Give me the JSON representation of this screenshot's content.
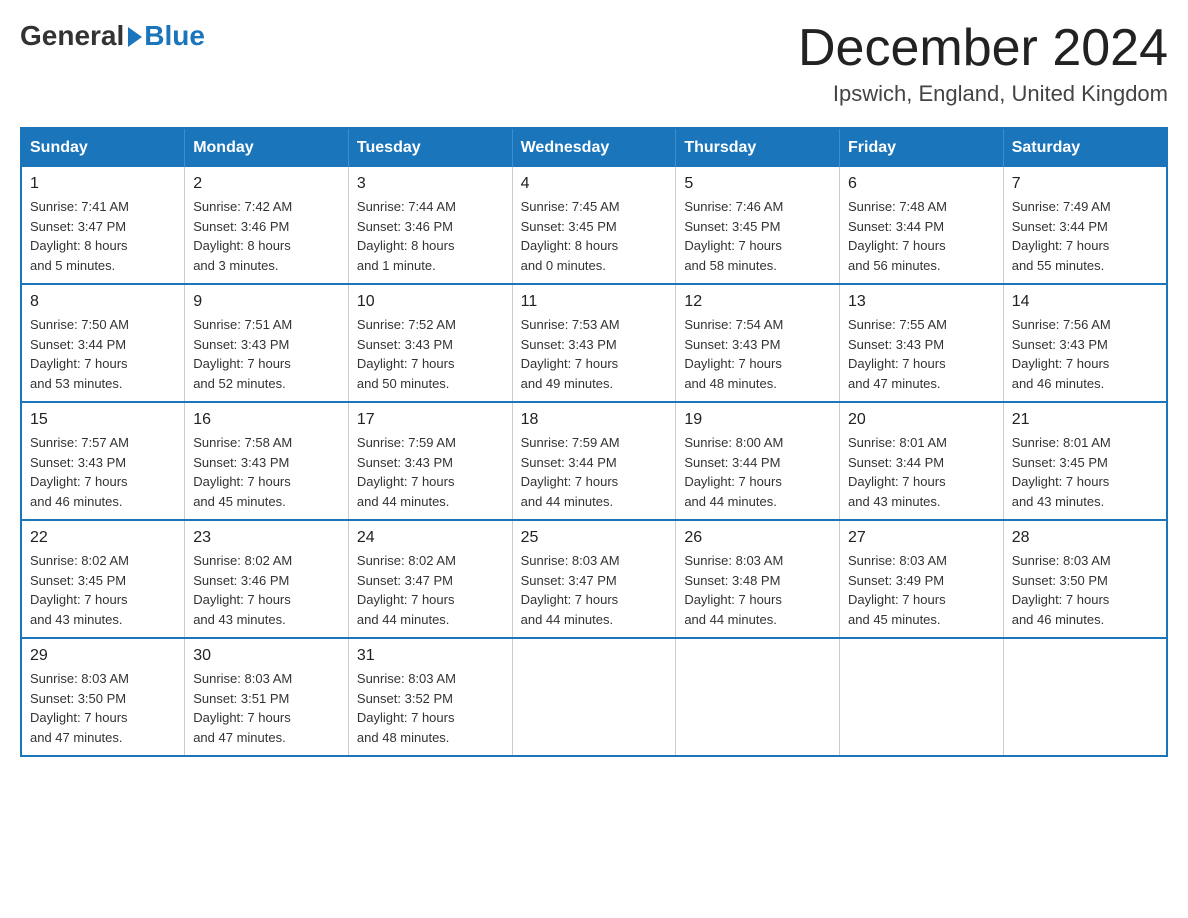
{
  "logo": {
    "general": "General",
    "blue": "Blue"
  },
  "title": "December 2024",
  "location": "Ipswich, England, United Kingdom",
  "days_of_week": [
    "Sunday",
    "Monday",
    "Tuesday",
    "Wednesday",
    "Thursday",
    "Friday",
    "Saturday"
  ],
  "weeks": [
    [
      {
        "day": "1",
        "sunrise": "7:41 AM",
        "sunset": "3:47 PM",
        "daylight": "8 hours and 5 minutes."
      },
      {
        "day": "2",
        "sunrise": "7:42 AM",
        "sunset": "3:46 PM",
        "daylight": "8 hours and 3 minutes."
      },
      {
        "day": "3",
        "sunrise": "7:44 AM",
        "sunset": "3:46 PM",
        "daylight": "8 hours and 1 minute."
      },
      {
        "day": "4",
        "sunrise": "7:45 AM",
        "sunset": "3:45 PM",
        "daylight": "8 hours and 0 minutes."
      },
      {
        "day": "5",
        "sunrise": "7:46 AM",
        "sunset": "3:45 PM",
        "daylight": "7 hours and 58 minutes."
      },
      {
        "day": "6",
        "sunrise": "7:48 AM",
        "sunset": "3:44 PM",
        "daylight": "7 hours and 56 minutes."
      },
      {
        "day": "7",
        "sunrise": "7:49 AM",
        "sunset": "3:44 PM",
        "daylight": "7 hours and 55 minutes."
      }
    ],
    [
      {
        "day": "8",
        "sunrise": "7:50 AM",
        "sunset": "3:44 PM",
        "daylight": "7 hours and 53 minutes."
      },
      {
        "day": "9",
        "sunrise": "7:51 AM",
        "sunset": "3:43 PM",
        "daylight": "7 hours and 52 minutes."
      },
      {
        "day": "10",
        "sunrise": "7:52 AM",
        "sunset": "3:43 PM",
        "daylight": "7 hours and 50 minutes."
      },
      {
        "day": "11",
        "sunrise": "7:53 AM",
        "sunset": "3:43 PM",
        "daylight": "7 hours and 49 minutes."
      },
      {
        "day": "12",
        "sunrise": "7:54 AM",
        "sunset": "3:43 PM",
        "daylight": "7 hours and 48 minutes."
      },
      {
        "day": "13",
        "sunrise": "7:55 AM",
        "sunset": "3:43 PM",
        "daylight": "7 hours and 47 minutes."
      },
      {
        "day": "14",
        "sunrise": "7:56 AM",
        "sunset": "3:43 PM",
        "daylight": "7 hours and 46 minutes."
      }
    ],
    [
      {
        "day": "15",
        "sunrise": "7:57 AM",
        "sunset": "3:43 PM",
        "daylight": "7 hours and 46 minutes."
      },
      {
        "day": "16",
        "sunrise": "7:58 AM",
        "sunset": "3:43 PM",
        "daylight": "7 hours and 45 minutes."
      },
      {
        "day": "17",
        "sunrise": "7:59 AM",
        "sunset": "3:43 PM",
        "daylight": "7 hours and 44 minutes."
      },
      {
        "day": "18",
        "sunrise": "7:59 AM",
        "sunset": "3:44 PM",
        "daylight": "7 hours and 44 minutes."
      },
      {
        "day": "19",
        "sunrise": "8:00 AM",
        "sunset": "3:44 PM",
        "daylight": "7 hours and 44 minutes."
      },
      {
        "day": "20",
        "sunrise": "8:01 AM",
        "sunset": "3:44 PM",
        "daylight": "7 hours and 43 minutes."
      },
      {
        "day": "21",
        "sunrise": "8:01 AM",
        "sunset": "3:45 PM",
        "daylight": "7 hours and 43 minutes."
      }
    ],
    [
      {
        "day": "22",
        "sunrise": "8:02 AM",
        "sunset": "3:45 PM",
        "daylight": "7 hours and 43 minutes."
      },
      {
        "day": "23",
        "sunrise": "8:02 AM",
        "sunset": "3:46 PM",
        "daylight": "7 hours and 43 minutes."
      },
      {
        "day": "24",
        "sunrise": "8:02 AM",
        "sunset": "3:47 PM",
        "daylight": "7 hours and 44 minutes."
      },
      {
        "day": "25",
        "sunrise": "8:03 AM",
        "sunset": "3:47 PM",
        "daylight": "7 hours and 44 minutes."
      },
      {
        "day": "26",
        "sunrise": "8:03 AM",
        "sunset": "3:48 PM",
        "daylight": "7 hours and 44 minutes."
      },
      {
        "day": "27",
        "sunrise": "8:03 AM",
        "sunset": "3:49 PM",
        "daylight": "7 hours and 45 minutes."
      },
      {
        "day": "28",
        "sunrise": "8:03 AM",
        "sunset": "3:50 PM",
        "daylight": "7 hours and 46 minutes."
      }
    ],
    [
      {
        "day": "29",
        "sunrise": "8:03 AM",
        "sunset": "3:50 PM",
        "daylight": "7 hours and 47 minutes."
      },
      {
        "day": "30",
        "sunrise": "8:03 AM",
        "sunset": "3:51 PM",
        "daylight": "7 hours and 47 minutes."
      },
      {
        "day": "31",
        "sunrise": "8:03 AM",
        "sunset": "3:52 PM",
        "daylight": "7 hours and 48 minutes."
      },
      null,
      null,
      null,
      null
    ]
  ],
  "labels": {
    "sunrise": "Sunrise:",
    "sunset": "Sunset:",
    "daylight": "Daylight:"
  }
}
